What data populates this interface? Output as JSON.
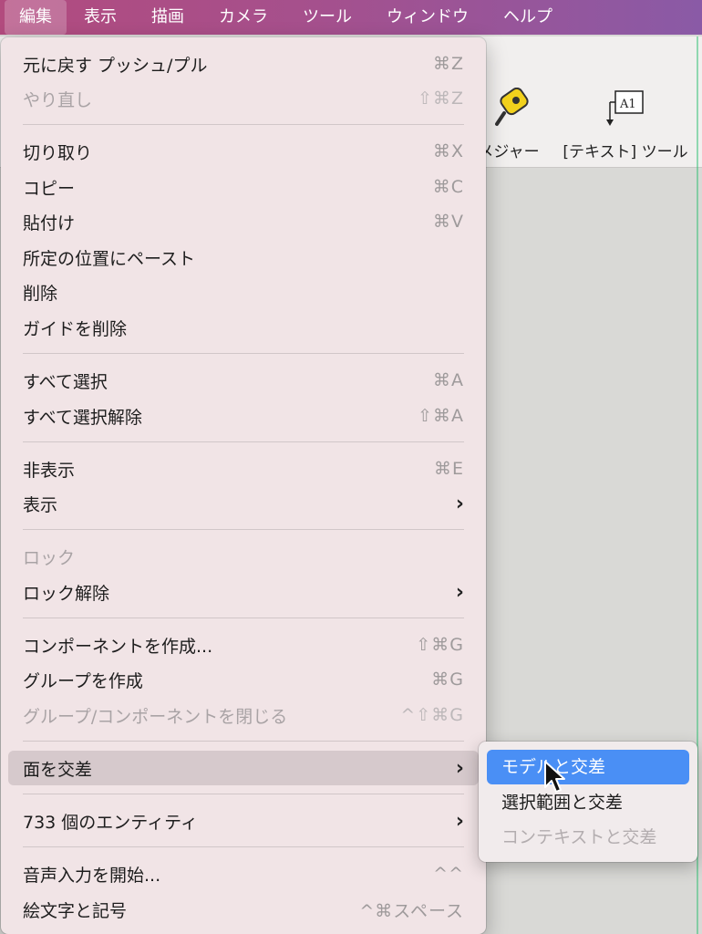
{
  "menubar": {
    "items": [
      "編集",
      "表示",
      "描画",
      "カメラ",
      "ツール",
      "ウィンドウ",
      "ヘルプ"
    ]
  },
  "toolbar": {
    "tools": [
      {
        "label": "メジャー",
        "icon": "tape-measure-icon"
      },
      {
        "label": "[テキスト] ツール",
        "icon": "text-tool-icon",
        "icon_text": "A1"
      }
    ]
  },
  "menu": {
    "items": [
      {
        "label": "元に戻す プッシュ/プル",
        "shortcut": "⌘Z"
      },
      {
        "label": "やり直し",
        "shortcut": "⇧⌘Z",
        "disabled": true
      },
      {
        "label": "切り取り",
        "shortcut": "⌘X"
      },
      {
        "label": "コピー",
        "shortcut": "⌘C"
      },
      {
        "label": "貼付け",
        "shortcut": "⌘V"
      },
      {
        "label": "所定の位置にペースト",
        "shortcut": ""
      },
      {
        "label": "削除",
        "shortcut": ""
      },
      {
        "label": "ガイドを削除",
        "shortcut": ""
      },
      {
        "label": "すべて選択",
        "shortcut": "⌘A"
      },
      {
        "label": "すべて選択解除",
        "shortcut": "⇧⌘A"
      },
      {
        "label": "非表示",
        "shortcut": "⌘E"
      },
      {
        "label": "表示",
        "submenu": true
      },
      {
        "label": "ロック",
        "disabled": true
      },
      {
        "label": "ロック解除",
        "submenu": true
      },
      {
        "label": "コンポーネントを作成...",
        "shortcut": "⇧⌘G"
      },
      {
        "label": "グループを作成",
        "shortcut": "⌘G"
      },
      {
        "label": "グループ/コンポーネントを閉じる",
        "shortcut": "^⇧⌘G",
        "disabled": true
      },
      {
        "label": "面を交差",
        "submenu": true,
        "highlighted": true
      },
      {
        "label": "733 個のエンティティ",
        "submenu": true
      },
      {
        "label": "音声入力を開始...",
        "shortcut": "^^"
      },
      {
        "label": "絵文字と記号",
        "shortcut": "^⌘スペース"
      }
    ],
    "submenu_chevron": "›"
  },
  "submenu": {
    "items": [
      {
        "label": "モデルと交差",
        "selected": true
      },
      {
        "label": "選択範囲と交差"
      },
      {
        "label": "コンテキストと交差",
        "disabled": true
      }
    ]
  },
  "colors": {
    "menubar_start": "#b24b7e",
    "menubar_end": "#8a5aa6",
    "selection": "#4a8ff5",
    "menu_bg": "#f1e4e6"
  }
}
